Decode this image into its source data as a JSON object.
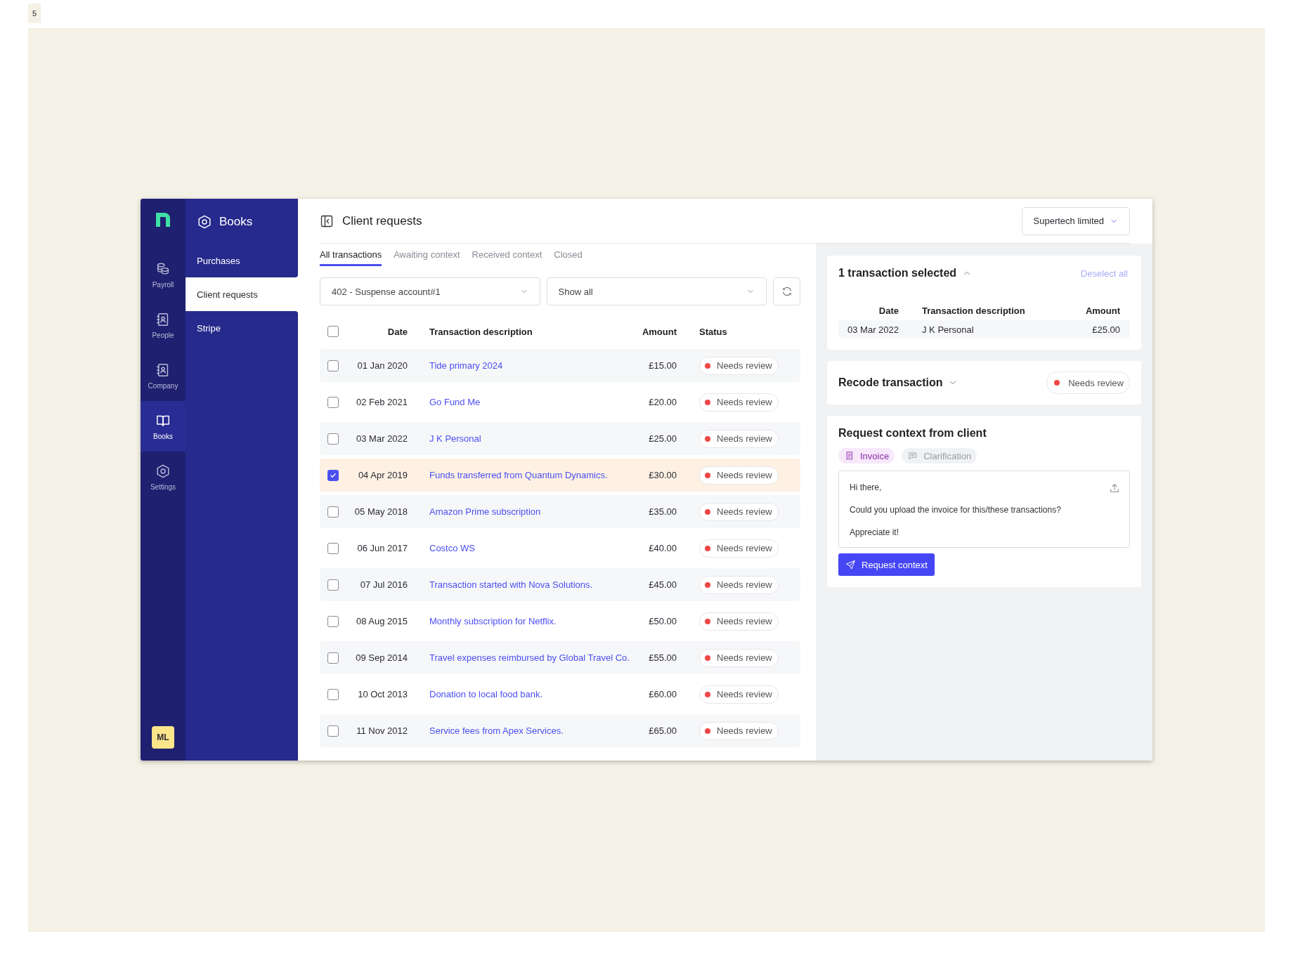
{
  "page_tag": "5",
  "rail": {
    "items": [
      {
        "label": "Payroll",
        "selected": false
      },
      {
        "label": "People",
        "selected": false
      },
      {
        "label": "Company",
        "selected": false
      },
      {
        "label": "Books",
        "selected": true
      },
      {
        "label": "Settings",
        "selected": false
      }
    ],
    "avatar": "ML"
  },
  "section_nav": {
    "title": "Books",
    "items": [
      {
        "label": "Purchases",
        "selected": false
      },
      {
        "label": "Client requests",
        "selected": true
      },
      {
        "label": "Stripe",
        "selected": false
      }
    ]
  },
  "header": {
    "title": "Client requests",
    "company": "Supertech limited"
  },
  "tabs": [
    {
      "label": "All transactions",
      "selected": true
    },
    {
      "label": "Awaiting context",
      "selected": false
    },
    {
      "label": "Received context",
      "selected": false
    },
    {
      "label": "Closed",
      "selected": false
    }
  ],
  "filters": {
    "account": "402 - Suspense account#1",
    "show": "Show all"
  },
  "table": {
    "all_checked": false,
    "columns": [
      "Date",
      "Transaction description",
      "Amount",
      "Status"
    ],
    "rows": [
      {
        "checked": false,
        "date": "01 Jan 2020",
        "description": "Tide primary 2024",
        "amount": "£15.00",
        "status": "Needs review"
      },
      {
        "checked": false,
        "date": "02 Feb 2021",
        "description": "Go Fund Me",
        "amount": "£20.00",
        "status": "Needs review"
      },
      {
        "checked": false,
        "date": "03 Mar 2022",
        "description": "J K Personal",
        "amount": "£25.00",
        "status": "Needs review"
      },
      {
        "checked": true,
        "date": "04 Apr 2019",
        "description": "Funds transferred from Quantum Dynamics.",
        "amount": "£30.00",
        "status": "Needs review"
      },
      {
        "checked": false,
        "date": "05 May 2018",
        "description": "Amazon Prime subscription",
        "amount": "£35.00",
        "status": "Needs review"
      },
      {
        "checked": false,
        "date": "06 Jun 2017",
        "description": "Costco WS",
        "amount": "£40.00",
        "status": "Needs review"
      },
      {
        "checked": false,
        "date": "07 Jul 2016",
        "description": "Transaction started with Nova Solutions.",
        "amount": "£45.00",
        "status": "Needs review"
      },
      {
        "checked": false,
        "date": "08 Aug 2015",
        "description": "Monthly subscription for Netflix.",
        "amount": "£50.00",
        "status": "Needs review"
      },
      {
        "checked": false,
        "date": "09 Sep 2014",
        "description": "Travel expenses reimbursed by Global Travel Co.",
        "amount": "£55.00",
        "status": "Needs review"
      },
      {
        "checked": false,
        "date": "10 Oct 2013",
        "description": "Donation to local food bank.",
        "amount": "£60.00",
        "status": "Needs review"
      },
      {
        "checked": false,
        "date": "11 Nov 2012",
        "description": "Service fees from Apex Services.",
        "amount": "£65.00",
        "status": "Needs review"
      }
    ]
  },
  "selection": {
    "title": "1 transaction selected",
    "expanded": true,
    "deselect": "Deselect all",
    "columns": [
      "Date",
      "Transaction description",
      "Amount"
    ],
    "rows": [
      {
        "date": "03 Mar 2022",
        "description": "J K Personal",
        "amount": "£25.00"
      }
    ]
  },
  "recode": {
    "title": "Recode transaction",
    "expanded": false,
    "status": "Needs review"
  },
  "request": {
    "title": "Request context from client",
    "types": [
      {
        "label": "Invoice",
        "kind": "invoice",
        "selected": true
      },
      {
        "label": "Clarification",
        "kind": "clarification",
        "selected": false
      }
    ],
    "message": [
      "Hi there,",
      "Could you upload the invoice for this/these transactions?",
      "Appreciate it!"
    ],
    "button": "Request context"
  }
}
